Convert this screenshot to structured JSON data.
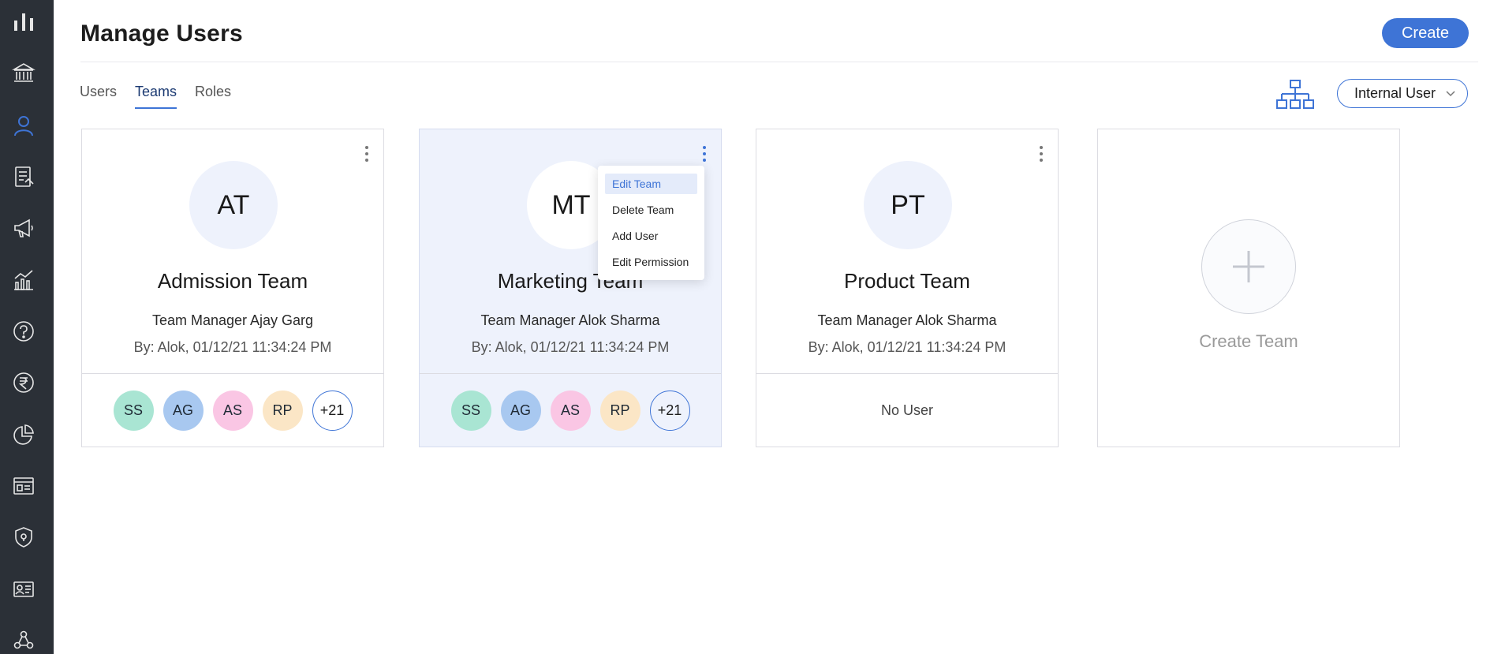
{
  "sidebar": {
    "icons": [
      "bar-chart-icon",
      "bank-icon",
      "user-icon",
      "document-icon",
      "megaphone-icon",
      "analytics-icon",
      "help-icon",
      "rupee-icon",
      "pie-chart-icon",
      "browser-window-icon",
      "shield-icon",
      "id-card-icon",
      "network-icon"
    ],
    "active_icon": "user-icon",
    "active_color": "#3e74d6"
  },
  "header": {
    "title": "Manage Users",
    "create_label": "Create"
  },
  "tabs": [
    {
      "label": "Users",
      "active": false
    },
    {
      "label": "Teams",
      "active": true
    },
    {
      "label": "Roles",
      "active": false
    }
  ],
  "filter": {
    "selected": "Internal User"
  },
  "cards": [
    {
      "initials": "AT",
      "name": "Admission Team",
      "manager": "Team Manager Ajay Garg",
      "by": "By: Alok, 01/12/21 11:34:24 PM",
      "members": [
        "SS",
        "AG",
        "AS",
        "RP"
      ],
      "more": "+21"
    },
    {
      "initials": "MT",
      "name": "Marketing Team",
      "manager": "Team Manager Alok Sharma",
      "by": "By: Alok, 01/12/21 11:34:24 PM",
      "members": [
        "SS",
        "AG",
        "AS",
        "RP"
      ],
      "more": "+21"
    },
    {
      "initials": "PT",
      "name": "Product Team",
      "manager": "Team Manager Alok Sharma",
      "by": "By: Alok, 01/12/21 11:34:24 PM",
      "no_user": "No User"
    }
  ],
  "context_menu": {
    "items": [
      "Edit Team",
      "Delete Team",
      "Add User",
      "Edit Permission"
    ],
    "active": "Edit Team"
  },
  "create_card": {
    "label": "Create Team"
  },
  "colors": {
    "accent": "#3e74d6",
    "sidebar_bg": "#2b3037",
    "highlight_card": "#eef2fc"
  }
}
